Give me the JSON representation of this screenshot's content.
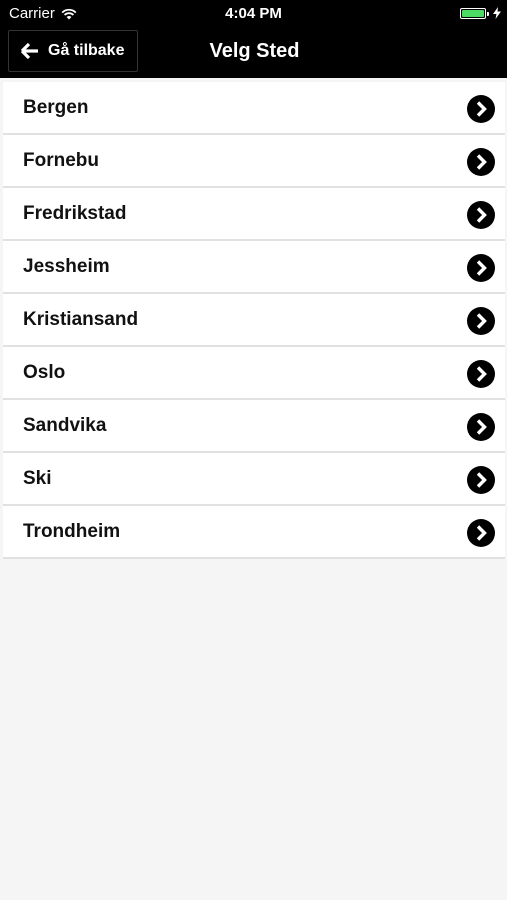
{
  "status_bar": {
    "carrier": "Carrier",
    "time": "4:04 PM",
    "battery_level": 1.0,
    "battery_color": "#4cd964"
  },
  "nav": {
    "back_label": "Gå tilbake",
    "back_icon": "arrow-left-icon",
    "title": "Velg Sted"
  },
  "locations": [
    {
      "label": "Bergen"
    },
    {
      "label": "Fornebu"
    },
    {
      "label": "Fredrikstad"
    },
    {
      "label": "Jessheim"
    },
    {
      "label": "Kristiansand"
    },
    {
      "label": "Oslo"
    },
    {
      "label": "Sandvika"
    },
    {
      "label": "Ski"
    },
    {
      "label": "Trondheim"
    }
  ],
  "item_icon": "chevron-right-circle-icon"
}
